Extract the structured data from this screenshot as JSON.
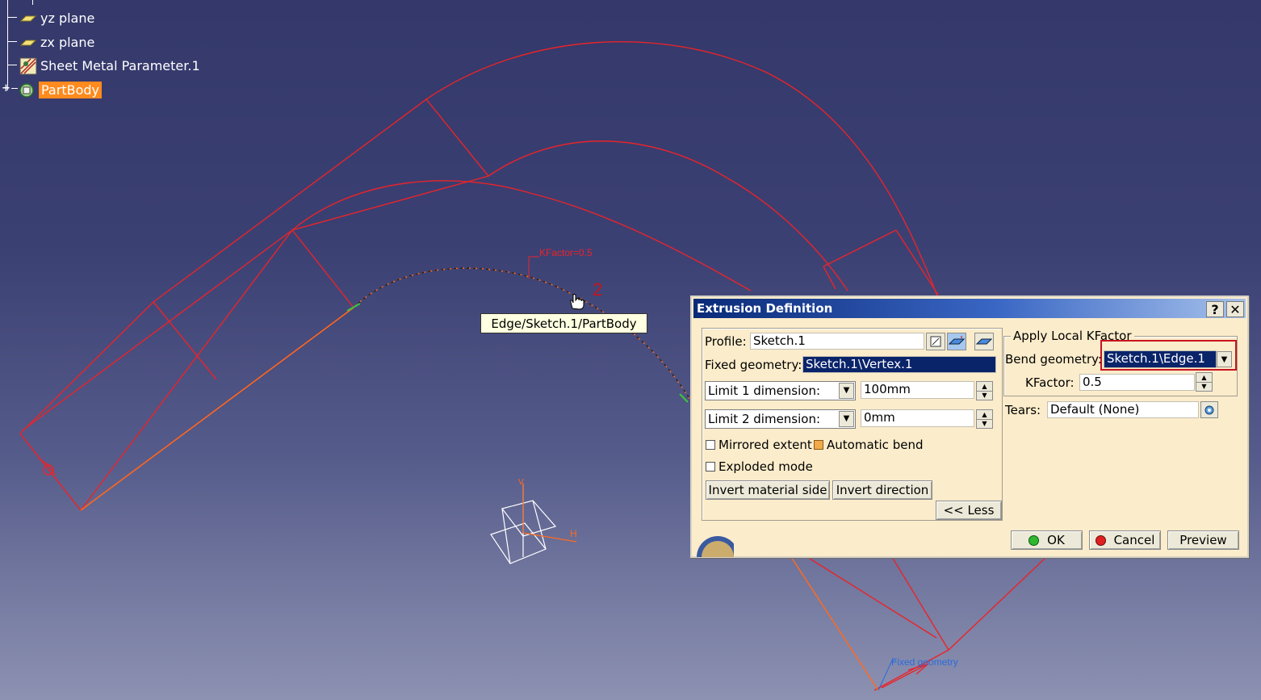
{
  "tree": {
    "items": [
      {
        "label": "yz plane",
        "icon": "plane-icon"
      },
      {
        "label": "zx plane",
        "icon": "plane-icon"
      },
      {
        "label": "Sheet Metal Parameter.1",
        "icon": "sheet-metal-parameter-icon"
      },
      {
        "label": "PartBody",
        "icon": "partbody-icon",
        "selected": true
      }
    ],
    "expander": "+"
  },
  "viewport": {
    "tooltip": "Edge/Sketch.1/PartBody",
    "marker_1": "1",
    "marker_2": "2",
    "kfactor_annotation": "KFactor=0.5",
    "fixed_geometry_annotation": "Fixed geometry",
    "axis_h": "H",
    "axis_v": "V"
  },
  "dialog": {
    "title": "Extrusion Definition",
    "help_button": "?",
    "close_button": "✕",
    "profile_label": "Profile:",
    "profile_value": "Sketch.1",
    "fixed_geometry_label": "Fixed geometry:",
    "fixed_geometry_value": "Sketch.1\\Vertex.1",
    "limit1_type": "Limit 1 dimension:",
    "limit1_value": "100mm",
    "limit2_type": "Limit 2 dimension:",
    "limit2_value": "0mm",
    "mirrored_extent_label": "Mirrored extent",
    "mirrored_extent_checked": false,
    "automatic_bend_label": "Automatic bend",
    "automatic_bend_checked": true,
    "exploded_mode_label": "Exploded mode",
    "exploded_mode_checked": false,
    "invert_material_side": "Invert material side",
    "invert_direction": "Invert direction",
    "less_button": "<< Less",
    "apply_local_kfactor_label": "Apply Local KFactor",
    "bend_geometry_label": "Bend geometry:",
    "bend_geometry_value": "Sketch.1\\Edge.1",
    "kfactor_label": "KFactor:",
    "kfactor_value": "0.5",
    "tears_label": "Tears:",
    "tears_value": "Default (None)",
    "ok_button": "OK",
    "cancel_button": "Cancel",
    "preview_button": "Preview"
  },
  "colors": {
    "geometry": "#e8242a",
    "selected_edge": "#ff6a1e",
    "tree_selected": "#ff8a1e",
    "dialog_bg": "#fbeccb",
    "highlight": "#c8141e"
  }
}
